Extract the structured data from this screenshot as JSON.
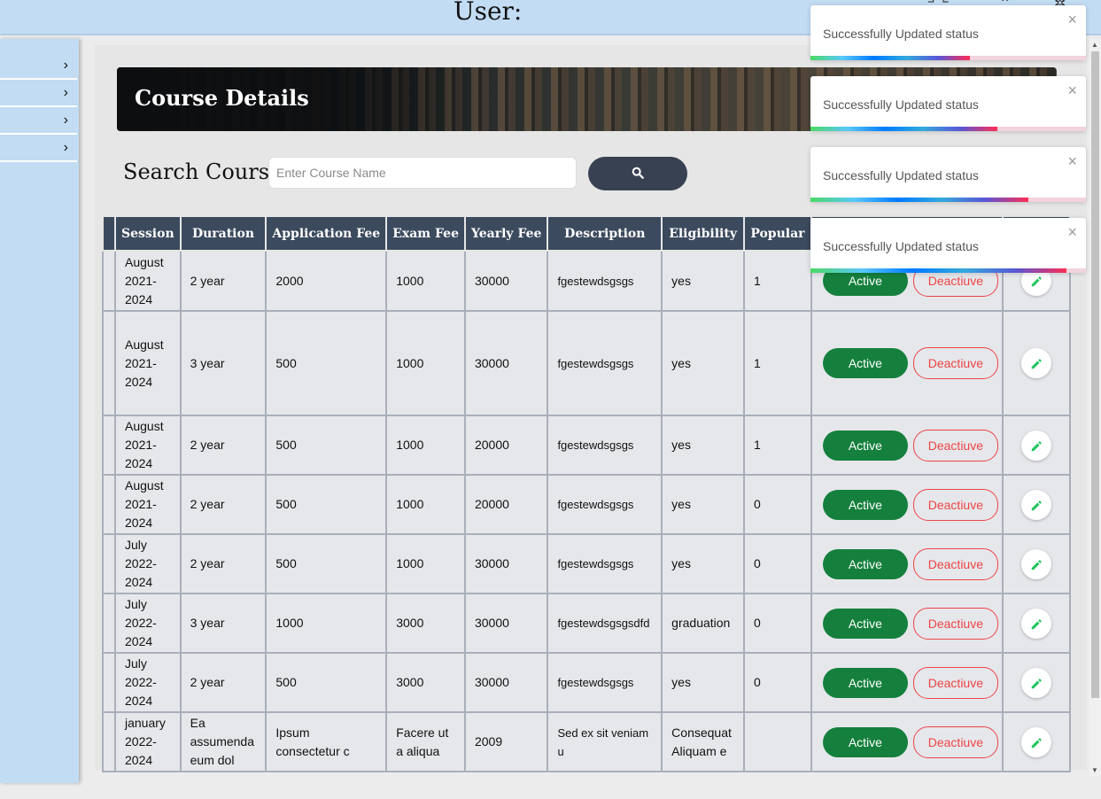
{
  "header": {
    "title": "User:"
  },
  "sidebar": {
    "items": [
      {
        "icon": "chevron-right-icon"
      },
      {
        "icon": "chevron-right-icon"
      },
      {
        "icon": "chevron-right-icon"
      },
      {
        "icon": "chevron-right-icon"
      }
    ]
  },
  "banner": {
    "title": "Course Details"
  },
  "search": {
    "label": "Search Course",
    "placeholder": "Enter Course Name",
    "button_icon": "search-icon"
  },
  "table": {
    "headers": [
      "Session",
      "Duration",
      "Application Fee",
      "Exam Fee",
      "Yearly Fee",
      "Description",
      "Eligibility",
      "Popular",
      "",
      ""
    ],
    "rows": [
      {
        "session": "August 2021-2024",
        "duration": "2 year",
        "application_fee": "2000",
        "exam_fee": "1000",
        "yearly_fee": "30000",
        "description": "fgestewdsgsgs",
        "eligibility": "yes",
        "popular": "1",
        "active_label": "Active",
        "deactive_label": "Deactiuve"
      },
      {
        "session": "August 2021-2024",
        "duration": "3 year",
        "application_fee": "500",
        "exam_fee": "1000",
        "yearly_fee": "30000",
        "description": "fgestewdsgsgs",
        "eligibility": "yes",
        "popular": "1",
        "active_label": "Active",
        "deactive_label": "Deactiuve"
      },
      {
        "session": "August 2021-2024",
        "duration": "2 year",
        "application_fee": "500",
        "exam_fee": "1000",
        "yearly_fee": "20000",
        "description": "fgestewdsgsgs",
        "eligibility": "yes",
        "popular": "1",
        "active_label": "Active",
        "deactive_label": "Deactiuve"
      },
      {
        "session": "August 2021-2024",
        "duration": "2 year",
        "application_fee": "500",
        "exam_fee": "1000",
        "yearly_fee": "20000",
        "description": "fgestewdsgsgs",
        "eligibility": "yes",
        "popular": "0",
        "active_label": "Active",
        "deactive_label": "Deactiuve"
      },
      {
        "session": "July 2022-2024",
        "duration": "2 year",
        "application_fee": "500",
        "exam_fee": "1000",
        "yearly_fee": "30000",
        "description": "fgestewdsgsgs",
        "eligibility": "yes",
        "popular": "0",
        "active_label": "Active",
        "deactive_label": "Deactiuve"
      },
      {
        "session": "July 2022-2024",
        "duration": "3 year",
        "application_fee": "1000",
        "exam_fee": "3000",
        "yearly_fee": "30000",
        "description": "fgestewdsgsgsdfd",
        "eligibility": "graduation",
        "popular": "0",
        "active_label": "Active",
        "deactive_label": "Deactiuve"
      },
      {
        "session": "July 2022-2024",
        "duration": "2 year",
        "application_fee": "500",
        "exam_fee": "3000",
        "yearly_fee": "30000",
        "description": "fgestewdsgsgs",
        "eligibility": "yes",
        "popular": "0",
        "active_label": "Active",
        "deactive_label": "Deactiuve"
      },
      {
        "session": "january 2022-2024",
        "duration": "Ea assumenda eum dol",
        "application_fee": "Ipsum consectetur c",
        "exam_fee": "Facere ut a aliqua",
        "yearly_fee": "2009",
        "description": "Sed ex sit veniam u",
        "eligibility": "Consequat Aliquam e",
        "popular": "",
        "active_label": "Active",
        "deactive_label": "Deactiuve"
      }
    ]
  },
  "toasts": [
    {
      "message": "Successfully Updated status",
      "progress": 0.58
    },
    {
      "message": "Successfully Updated status",
      "progress": 0.68
    },
    {
      "message": "Successfully Updated status",
      "progress": 0.79
    },
    {
      "message": "Successfully Updated status",
      "progress": 0.93
    }
  ],
  "colors": {
    "topbar": "#c2dcf3",
    "header_bg": "#3c4a5e",
    "active": "#15803d",
    "deactive": "#ef4444",
    "edit_icon": "#22c55e"
  }
}
